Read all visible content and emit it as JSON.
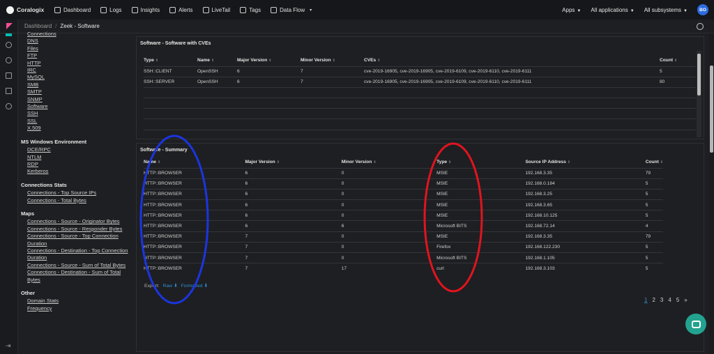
{
  "colors": {
    "accent": "#2e8fd6",
    "annotation_blue": "#1b35e0",
    "annotation_red": "#e0141e",
    "avatar": "#2d6cdf",
    "chat": "#23a290"
  },
  "topnav": {
    "brand": "Coralogix",
    "items": [
      {
        "label": "Dashboard",
        "icon": "dashboard-icon"
      },
      {
        "label": "Logs",
        "icon": "logs-icon"
      },
      {
        "label": "Insights",
        "icon": "insights-icon"
      },
      {
        "label": "Alerts",
        "icon": "bell-icon"
      },
      {
        "label": "LiveTail",
        "icon": "play-icon"
      },
      {
        "label": "Tags",
        "icon": "tag-icon"
      },
      {
        "label": "Data Flow",
        "icon": "dataflow-icon"
      }
    ],
    "apps": "Apps",
    "applications": "All applications",
    "subsystems": "All subsystems",
    "avatar_initials": "BO"
  },
  "breadcrumb": {
    "root": "Dashboard",
    "current": "Zeek - Software"
  },
  "sidebar": {
    "top_links": [
      "Connections",
      "DNS",
      "Files",
      "FTP",
      "HTTP",
      "IRC",
      "MySQL",
      "SMB",
      "SMTP",
      "SNMP",
      "Software",
      "SSH",
      "SSL",
      "X.509"
    ],
    "groups": [
      {
        "title": "MS Windows Environment",
        "links": [
          "DCE/RPC",
          "NTLM",
          "RDP",
          "Kerberos"
        ]
      },
      {
        "title": "Connections Stats",
        "links": [
          "Connections - Top Source IPs",
          "Connections - Total Bytes"
        ]
      },
      {
        "title": "Maps",
        "links": [
          "Connections - Source - Originator Bytes",
          "Connections - Source - Responder Bytes",
          "Connections - Source - Top Connection Duration",
          "Connections - Destination - Top Connection Duration",
          "Connections - Source - Sum of Total Bytes",
          "Connections - Destination - Sum of Total Bytes"
        ]
      },
      {
        "title": "Other",
        "links": [
          "Domain Stats",
          "Frequency"
        ]
      }
    ]
  },
  "cve_panel": {
    "title": "Software - Software with CVEs",
    "columns": [
      "Type",
      "Name",
      "Major Version",
      "Minor Version",
      "CVEs",
      "Count"
    ],
    "rows": [
      [
        "SSH::CLIENT",
        "OpenSSH",
        "6",
        "7",
        "cve-2019-16905, cve-2019-16905, cve-2019-6109, cve-2019-6110, cve-2019-6111",
        "5"
      ],
      [
        "SSH::SERVER",
        "OpenSSH",
        "6",
        "7",
        "cve-2019-16905, cve-2019-16905, cve-2019-6109, cve-2019-6110, cve-2019-6111",
        "80"
      ]
    ]
  },
  "summary_panel": {
    "title": "Software - Summary",
    "columns": [
      "Name",
      "Major Version",
      "Minor Version",
      "Type",
      "Source IP Address",
      "Count"
    ],
    "rows": [
      [
        "HTTP::BROWSER",
        "6",
        "0",
        "MSIE",
        "192.168.3.35",
        "79"
      ],
      [
        "HTTP::BROWSER",
        "6",
        "0",
        "MSIE",
        "192.168.0.184",
        "5"
      ],
      [
        "HTTP::BROWSER",
        "6",
        "0",
        "MSIE",
        "192.168.3.25",
        "5"
      ],
      [
        "HTTP::BROWSER",
        "6",
        "0",
        "MSIE",
        "192.168.3.65",
        "5"
      ],
      [
        "HTTP::BROWSER",
        "6",
        "0",
        "MSIE",
        "192.168.10.125",
        "5"
      ],
      [
        "HTTP::BROWSER",
        "6",
        "6",
        "Microsoft BITS",
        "192.168.72.14",
        "4"
      ],
      [
        "HTTP::BROWSER",
        "7",
        "0",
        "MSIE",
        "192.168.3.35",
        "79"
      ],
      [
        "HTTP::BROWSER",
        "7",
        "0",
        "Firefox",
        "192.168.122.230",
        "5"
      ],
      [
        "HTTP::BROWSER",
        "7",
        "0",
        "Microsoft BITS",
        "192.168.1.105",
        "5"
      ],
      [
        "HTTP::BROWSER",
        "7",
        "17",
        "curl",
        "192.168.3.103",
        "5"
      ]
    ],
    "export_label": "Export:",
    "export_raw": "Raw",
    "export_formatted": "Formatted",
    "pages": [
      "1",
      "2",
      "3",
      "4",
      "5",
      "»"
    ]
  }
}
